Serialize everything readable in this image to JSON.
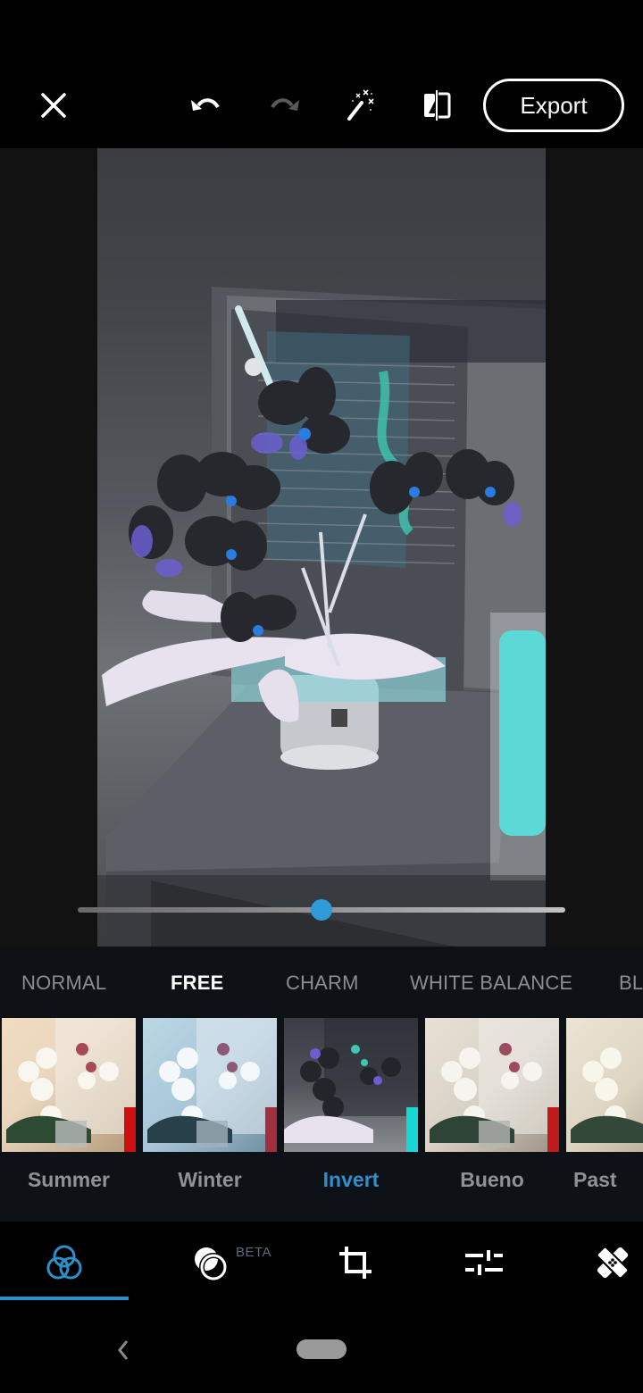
{
  "toolbar": {
    "close_icon": "close-icon",
    "undo_icon": "undo-icon",
    "redo_icon": "redo-icon",
    "auto_fix_icon": "magic-wand-icon",
    "compare_icon": "compare-icon",
    "export_label": "Export"
  },
  "editor": {
    "filter_strength_percent": 50,
    "accent_color": "#2f9ad8"
  },
  "categories": [
    {
      "label": "NORMAL",
      "active": false
    },
    {
      "label": "FREE",
      "active": true
    },
    {
      "label": "CHARM",
      "active": false
    },
    {
      "label": "WHITE BALANCE",
      "active": false
    },
    {
      "label": "BL",
      "active": false
    }
  ],
  "presets": [
    {
      "label": "Summer",
      "active": false
    },
    {
      "label": "Winter",
      "active": false
    },
    {
      "label": "Invert",
      "active": true
    },
    {
      "label": "Bueno",
      "active": false
    },
    {
      "label": "Past",
      "active": false
    }
  ],
  "bottom_nav": [
    {
      "name": "looks",
      "icon": "looks-icon",
      "active": true
    },
    {
      "name": "blend",
      "icon": "blend-icon",
      "badge": "BETA",
      "active": false
    },
    {
      "name": "crop",
      "icon": "crop-icon",
      "active": false
    },
    {
      "name": "adjust",
      "icon": "sliders-icon",
      "active": false
    },
    {
      "name": "heal",
      "icon": "bandage-icon",
      "active": false
    }
  ],
  "colors": {
    "active_blue": "#2f8fc8",
    "inactive_text": "#8a8d93",
    "panel_bg": "#0e1116"
  }
}
